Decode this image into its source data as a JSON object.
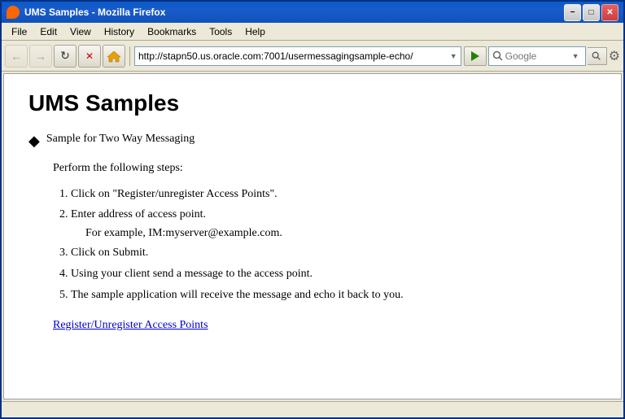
{
  "window": {
    "title": "UMS Samples - Mozilla Firefox",
    "title_icon": "firefox-icon"
  },
  "menu": {
    "items": [
      {
        "label": "File",
        "id": "file"
      },
      {
        "label": "Edit",
        "id": "edit"
      },
      {
        "label": "View",
        "id": "view"
      },
      {
        "label": "History",
        "id": "history"
      },
      {
        "label": "Bookmarks",
        "id": "bookmarks"
      },
      {
        "label": "Tools",
        "id": "tools"
      },
      {
        "label": "Help",
        "id": "help"
      }
    ]
  },
  "toolbar": {
    "back_title": "Back",
    "forward_title": "Forward",
    "refresh_title": "Refresh",
    "stop_title": "Stop",
    "home_title": "Home",
    "address_value": "http://stapn50.us.oracle.com:7001/usermessagingsample-echo/",
    "address_placeholder": "",
    "search_placeholder": "Google",
    "go_title": "Go"
  },
  "page": {
    "title": "UMS Samples",
    "bullet_label": "Sample for Two Way Messaging",
    "intro": "Perform the following steps:",
    "steps": [
      {
        "text": "Click on \"Register/unregister Access Points\".",
        "sub": null
      },
      {
        "text": "Enter address of access point.",
        "sub": "For example, IM:myserver@example.com."
      },
      {
        "text": "Click on Submit.",
        "sub": null
      },
      {
        "text": "Using your client send a message to the access point.",
        "sub": null
      },
      {
        "text": "The sample application will receive the message and echo it back to you.",
        "sub": null
      }
    ],
    "link_text": "Register/Unregister Access Points",
    "link_href": "#"
  },
  "title_buttons": {
    "minimize": "−",
    "maximize": "□",
    "close": "✕"
  }
}
